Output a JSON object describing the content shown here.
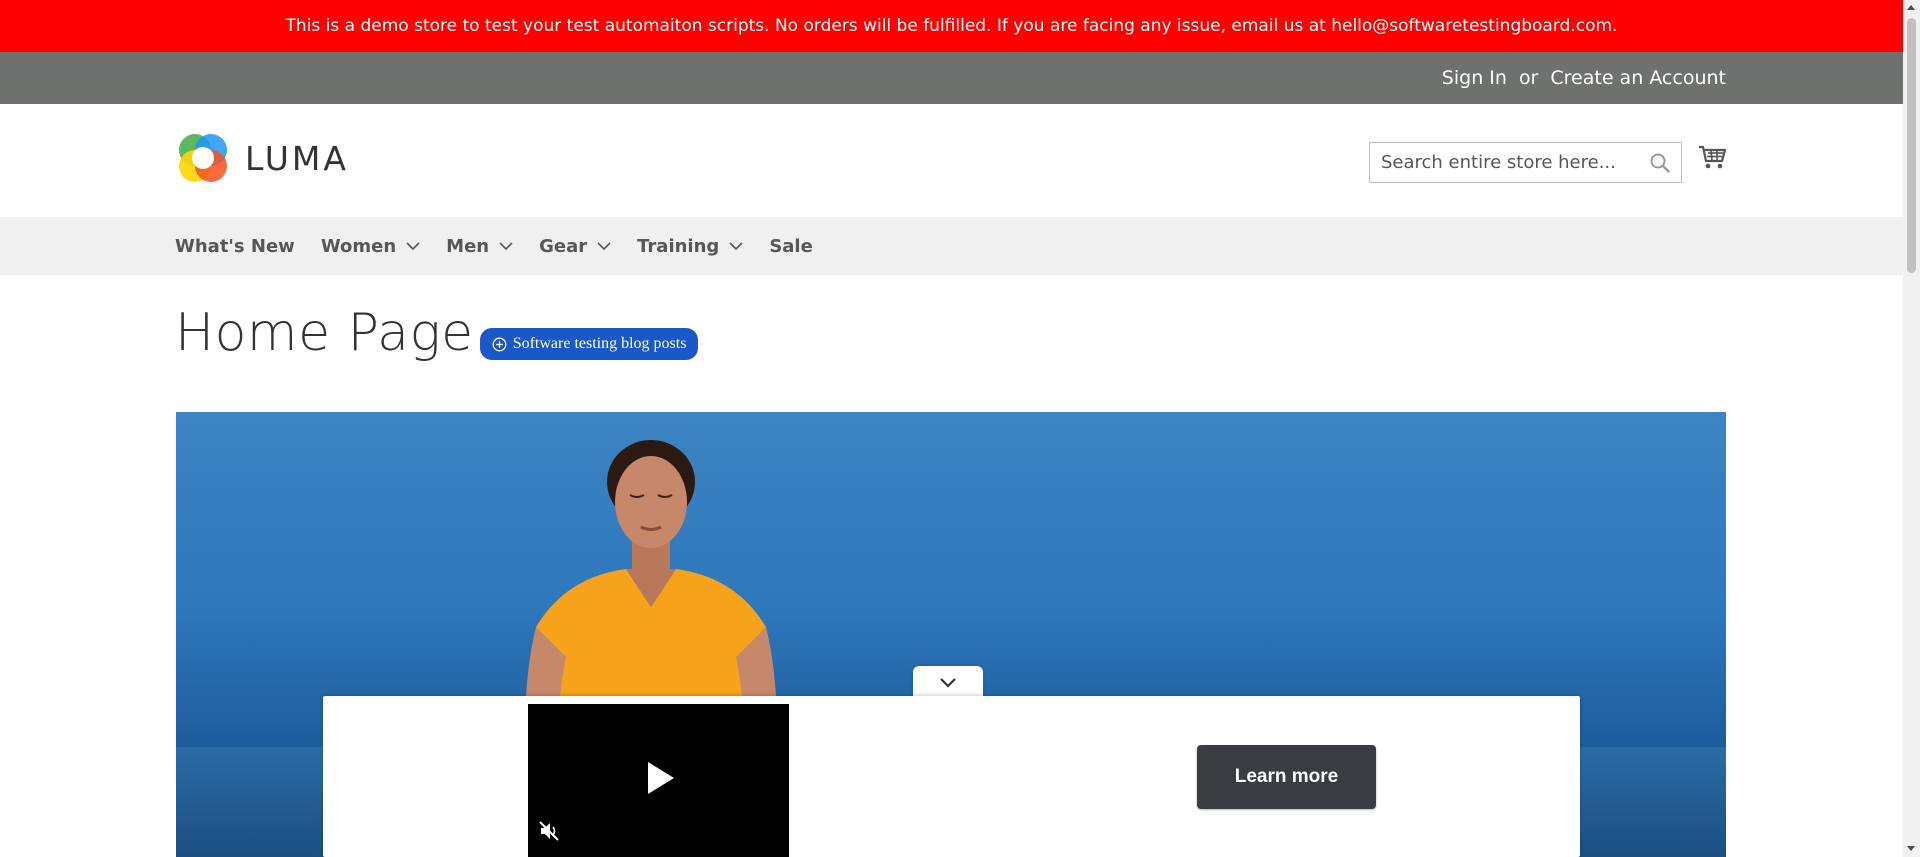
{
  "banner": {
    "text": "This is a demo store to test your test automaiton scripts. No orders will be fulfilled. If you are facing any issue, email us at hello@softwaretestingboard.com."
  },
  "top_links": {
    "sign_in": "Sign In",
    "or": "or",
    "create_account": "Create an Account"
  },
  "header": {
    "logo_text": "LUMA",
    "search_placeholder": "Search entire store here..."
  },
  "nav": {
    "items": [
      {
        "label": "What's New",
        "has_dropdown": false
      },
      {
        "label": "Women",
        "has_dropdown": true
      },
      {
        "label": "Men",
        "has_dropdown": true
      },
      {
        "label": "Gear",
        "has_dropdown": true
      },
      {
        "label": "Training",
        "has_dropdown": true
      },
      {
        "label": "Sale",
        "has_dropdown": false
      }
    ]
  },
  "page": {
    "title": "Home Page",
    "blog_pill": "Software testing blog posts"
  },
  "ad": {
    "learn_more": "Learn more"
  },
  "colors": {
    "banner_bg": "#ff0000",
    "top_bar_bg": "#6e716e",
    "nav_bg": "#f0f0f0",
    "pill_bg": "#1a57c9",
    "learn_more_bg": "#3a3c3f"
  }
}
